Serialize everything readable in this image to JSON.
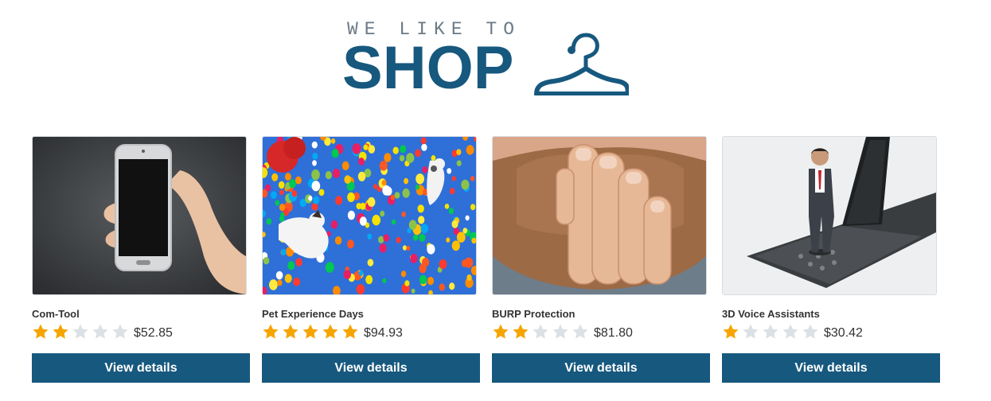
{
  "logo": {
    "tagline": "WE LIKE TO",
    "word": "SHOP",
    "icon": "hanger-icon",
    "color": "#17587e"
  },
  "colors": {
    "accent": "#17587e",
    "star_filled": "#f6a500",
    "star_empty": "#dbe1e5"
  },
  "products": [
    {
      "name": "Com-Tool",
      "rating": 2,
      "max_rating": 5,
      "price": "$52.85",
      "button": "View details",
      "image": "hand-holding-phone"
    },
    {
      "name": "Pet Experience Days",
      "rating": 5,
      "max_rating": 5,
      "price": "$94.93",
      "button": "View details",
      "image": "dogs-flying-with-balloons"
    },
    {
      "name": "BURP Protection",
      "rating": 2,
      "max_rating": 5,
      "price": "$81.80",
      "button": "View details",
      "image": "hand-over-bearded-mouth"
    },
    {
      "name": "3D Voice Assistants",
      "rating": 1,
      "max_rating": 5,
      "price": "$30.42",
      "button": "View details",
      "image": "tiny-man-on-flip-phone"
    }
  ]
}
